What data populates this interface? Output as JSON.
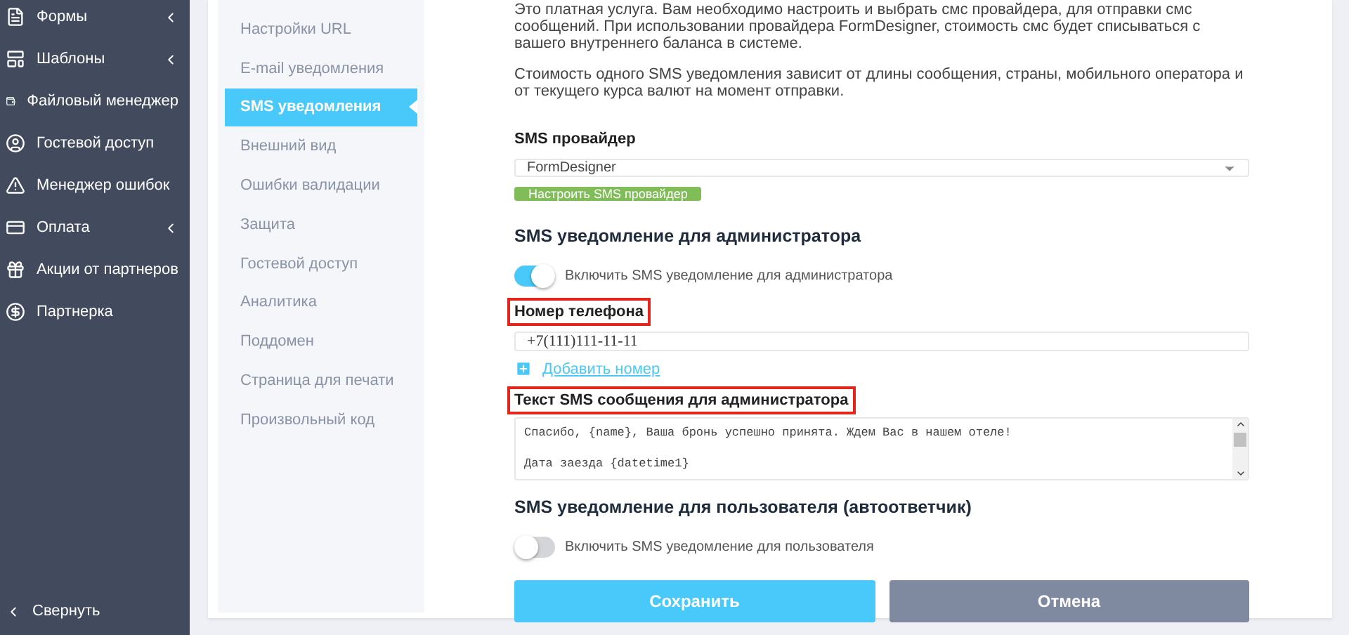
{
  "sidebar": {
    "items": [
      {
        "label": "Формы",
        "has_submenu": true
      },
      {
        "label": "Шаблоны",
        "has_submenu": true
      },
      {
        "label": "Файловый менеджер",
        "has_submenu": false
      },
      {
        "label": "Гостевой доступ",
        "has_submenu": false
      },
      {
        "label": "Менеджер ошибок",
        "has_submenu": false
      },
      {
        "label": "Оплата",
        "has_submenu": true
      },
      {
        "label": "Акции от партнеров",
        "has_submenu": false
      },
      {
        "label": "Партнерка",
        "has_submenu": false
      }
    ],
    "collapse": "Свернуть"
  },
  "settings_menu": [
    {
      "label": "Настройки URL",
      "selected": false
    },
    {
      "label": "E-mail уведомления",
      "selected": false
    },
    {
      "label": "SMS уведомления",
      "selected": true
    },
    {
      "label": "Внешний вид",
      "selected": false
    },
    {
      "label": "Ошибки валидации",
      "selected": false
    },
    {
      "label": "Защита",
      "selected": false
    },
    {
      "label": "Гостевой доступ",
      "selected": false
    },
    {
      "label": "Аналитика",
      "selected": false
    },
    {
      "label": "Поддомен",
      "selected": false
    },
    {
      "label": "Страница для печати",
      "selected": false
    },
    {
      "label": "Произвольный код",
      "selected": false
    }
  ],
  "intro": [
    "Это платная услуга. Вам необходимо настроить и выбрать смс провайдера, для отправки смс сообщений. При использовании провайдера FormDesigner, стоимость смс будет списываться с вашего внутреннего баланса в системе.",
    "Стоимость одного SMS уведомления зависит от длины сообщения, страны, мобильного оператора и от текущего курса валют на момент отправки."
  ],
  "provider": {
    "label": "SMS провайдер",
    "value": "FormDesigner",
    "configure_button": "Настроить SMS провайдер"
  },
  "admin": {
    "heading": "SMS уведомление для администратора",
    "toggle": {
      "label": "Включить SMS уведомление для администратора",
      "on": true
    },
    "phone": {
      "label": "Номер телефона",
      "highlighted": true,
      "value": "+7(111)111-11-11"
    },
    "add_number": "Добавить номер",
    "message": {
      "label": "Текст SMS сообщения для администратора",
      "highlighted": true,
      "value": "Спасибо, {name}, Ваша бронь успешно принята. Ждем Вас в нашем отеле!\n\nДата заезда {datetime1}"
    }
  },
  "user": {
    "heading": "SMS уведомление для пользователя (автоответчик)",
    "toggle": {
      "label": "Включить SMS уведомление для пользователя",
      "on": false
    }
  },
  "buttons": {
    "save": "Сохранить",
    "cancel": "Отмена"
  }
}
